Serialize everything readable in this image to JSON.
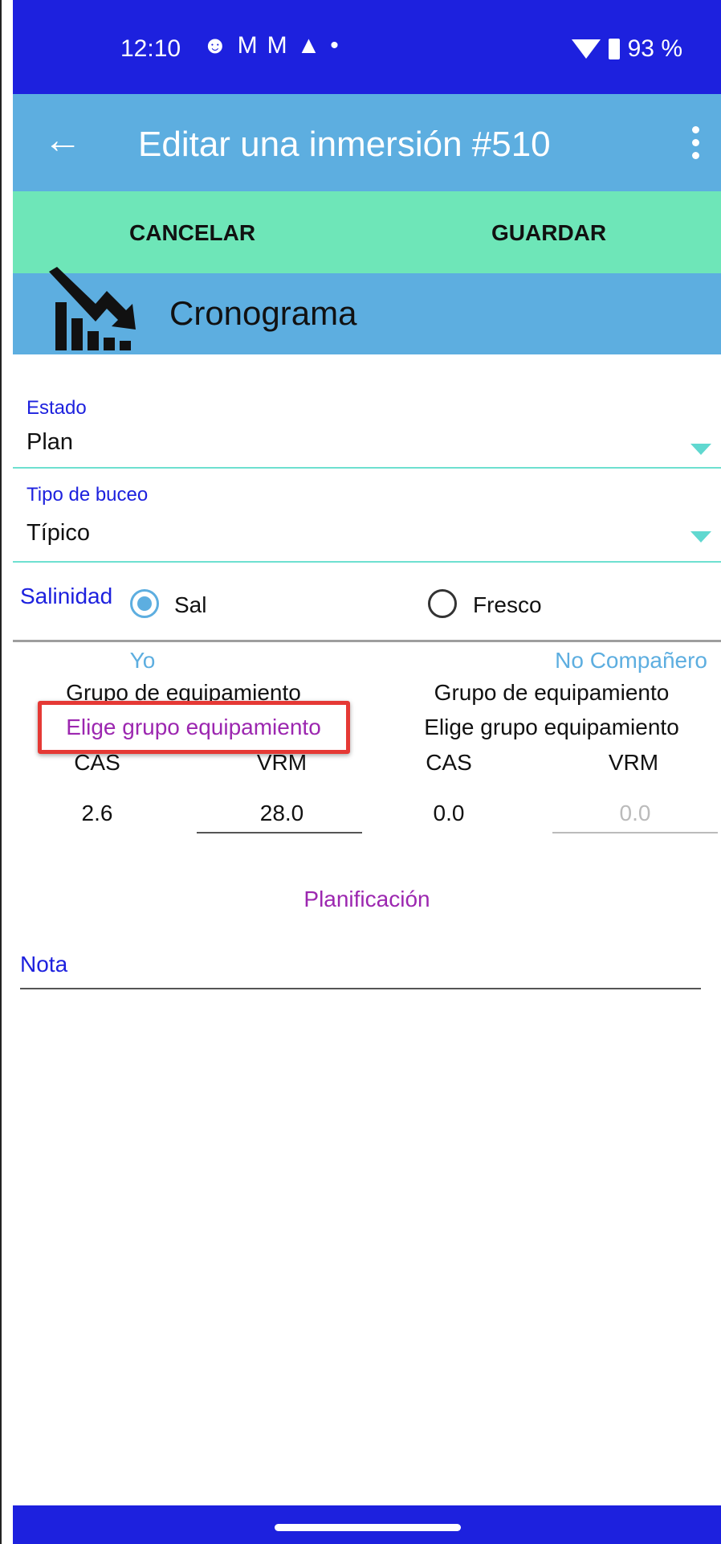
{
  "status_bar": {
    "time": "12:10",
    "notification_icons": [
      "face-icon",
      "gmail-icon",
      "gmail-icon",
      "warning-icon",
      "dot-icon"
    ],
    "battery": "93 %"
  },
  "app_bar": {
    "title": "Editar una inmersión #510"
  },
  "actions": {
    "cancel": "CANCELAR",
    "save": "GUARDAR"
  },
  "section": {
    "title": "Cronograma"
  },
  "estado": {
    "label": "Estado",
    "value": "Plan"
  },
  "tipo_buceo": {
    "label": "Tipo de buceo",
    "value": "Típico"
  },
  "salinidad": {
    "label": "Salinidad",
    "option_salt": "Sal",
    "option_fresh": "Fresco",
    "selected": "Sal"
  },
  "me": {
    "header": "Yo",
    "group_label": "Grupo de equipamiento",
    "group_link": "Elige grupo equipamiento",
    "cas_label": "CAS",
    "vrm_label": "VRM",
    "cas_value": "2.6",
    "vrm_value": "28.0"
  },
  "buddy": {
    "header": "No Compañero",
    "group_label": "Grupo de equipamiento",
    "group_link": "Elige grupo equipamiento",
    "cas_label": "CAS",
    "vrm_label": "VRM",
    "cas_value": "0.0",
    "vrm_value": "0.0"
  },
  "planning": {
    "label": "Planificación"
  },
  "note": {
    "label": "Nota"
  },
  "colors": {
    "status_bar": "#1d21de",
    "app_bar": "#5daee0",
    "action_bar": "#6ee6b8",
    "accent_purple": "#9c27b0",
    "highlight": "#e53935"
  }
}
